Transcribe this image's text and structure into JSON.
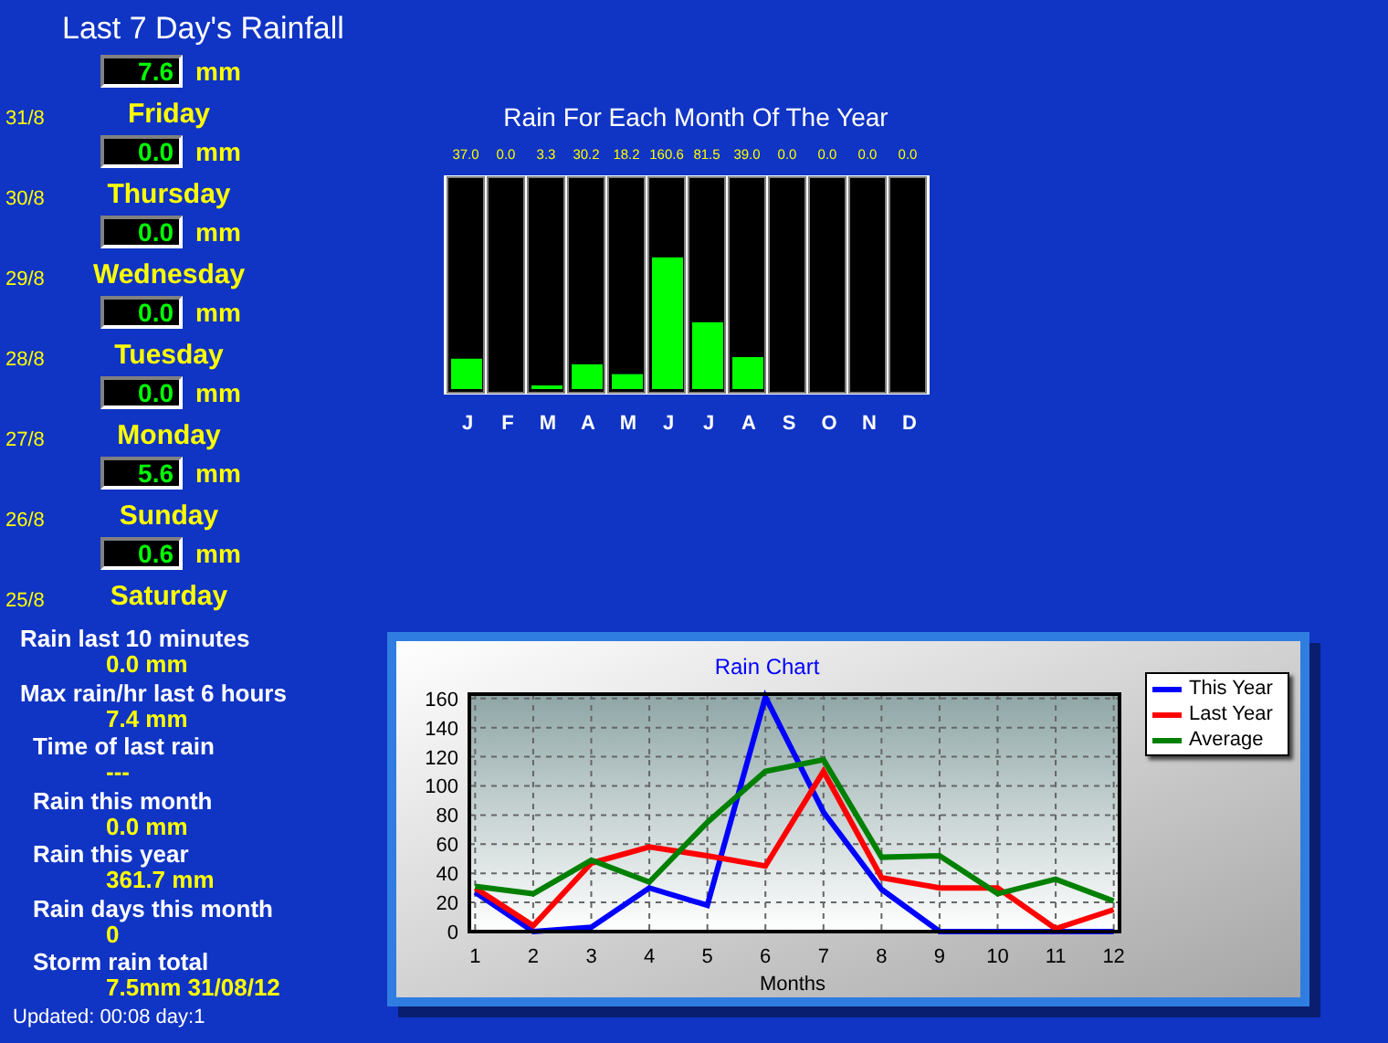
{
  "title": "Last 7 Day's Rainfall",
  "days": [
    {
      "value": "7.6",
      "unit": "mm",
      "date": "31/8",
      "day": "Friday"
    },
    {
      "value": "0.0",
      "unit": "mm",
      "date": "30/8",
      "day": "Thursday"
    },
    {
      "value": "0.0",
      "unit": "mm",
      "date": "29/8",
      "day": "Wednesday"
    },
    {
      "value": "0.0",
      "unit": "mm",
      "date": "28/8",
      "day": "Tuesday"
    },
    {
      "value": "0.0",
      "unit": "mm",
      "date": "27/8",
      "day": "Monday"
    },
    {
      "value": "5.6",
      "unit": "mm",
      "date": "26/8",
      "day": "Sunday"
    },
    {
      "value": "0.6",
      "unit": "mm",
      "date": "25/8",
      "day": "Saturday"
    }
  ],
  "stats": [
    {
      "label": "Rain last 10 minutes",
      "value": "0.0 mm"
    },
    {
      "label": "Max rain/hr last 6 hours",
      "value": "7.4 mm"
    },
    {
      "label": "Time of last rain",
      "value": "---"
    },
    {
      "label": "Rain this month",
      "value": "0.0 mm"
    },
    {
      "label": "Rain this year",
      "value": "361.7 mm"
    },
    {
      "label": "Rain days this month",
      "value": "0"
    },
    {
      "label": "Storm rain total",
      "value": "7.5mm 31/08/12"
    }
  ],
  "updated": "Updated: 00:08 day:1",
  "monthly_chart": {
    "chart_data": {
      "type": "bar",
      "title": "Rain For Each Month Of The Year",
      "categories": [
        "J",
        "F",
        "M",
        "A",
        "M",
        "J",
        "J",
        "A",
        "S",
        "O",
        "N",
        "D"
      ],
      "values": [
        37.0,
        0.0,
        3.3,
        30.2,
        18.2,
        160.6,
        81.5,
        39.0,
        0.0,
        0.0,
        0.0,
        0.0
      ],
      "value_labels": [
        "37.0",
        "0.0",
        "3.3",
        "30.2",
        "18.2",
        "160.6",
        "81.5",
        "39.0",
        "0.0",
        "0.0",
        "0.0",
        "0.0"
      ]
    }
  },
  "rain_chart": {
    "chart_data": {
      "type": "line",
      "title": "Rain Chart",
      "xlabel": "Months",
      "x": [
        1,
        2,
        3,
        4,
        5,
        6,
        7,
        8,
        9,
        10,
        11,
        12
      ],
      "xlim": [
        0.9,
        12.1
      ],
      "ylim": [
        0,
        163
      ],
      "grid": true,
      "legend": true,
      "yticks": [
        0,
        20,
        40,
        60,
        80,
        100,
        120,
        140,
        160
      ],
      "xticks": [
        1,
        2,
        3,
        4,
        5,
        6,
        7,
        8,
        9,
        10,
        11,
        12
      ],
      "series": [
        {
          "name": "This Year",
          "color": "#0000ff",
          "values": [
            27,
            0,
            3,
            30,
            18,
            161,
            82,
            29,
            0,
            0,
            0,
            0
          ]
        },
        {
          "name": "Last Year",
          "color": "#ff0000",
          "values": [
            30,
            4,
            47,
            58,
            52,
            45,
            110,
            37,
            30,
            30,
            2,
            15
          ]
        },
        {
          "name": "Average",
          "color": "#008000",
          "values": [
            31,
            26,
            49,
            34,
            75,
            110,
            118,
            51,
            52,
            26,
            36,
            21
          ]
        }
      ]
    }
  }
}
